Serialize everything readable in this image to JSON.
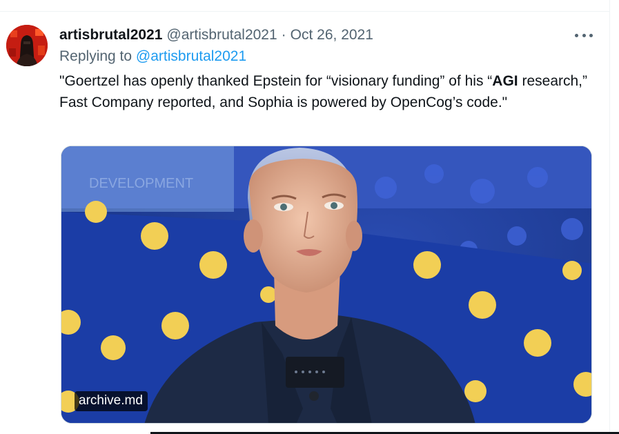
{
  "tweet": {
    "display_name": "artisbrutal2021",
    "handle": "@artisbrutal2021",
    "separator": "·",
    "date": "Oct 26, 2021",
    "replying_prefix": "Replying to",
    "replying_handle": "@artisbrutal2021",
    "text_part1": "\"Goertzel has openly thanked Epstein for “visionary funding” of his “",
    "text_bold": "AGI",
    "text_part2": " research,” Fast Company reported, and Sophia is powered by OpenCog’s code.\"",
    "media_source": "archive.md"
  },
  "icons": {
    "more": "more-horizontal-icon",
    "avatar": "dark-figure-on-red-avatar"
  },
  "colors": {
    "link": "#1d9bf0",
    "secondary_text": "#536471",
    "primary_text": "#0f1419",
    "image_background": "#1f3f9c",
    "polka_dot": "#f2cf55"
  }
}
